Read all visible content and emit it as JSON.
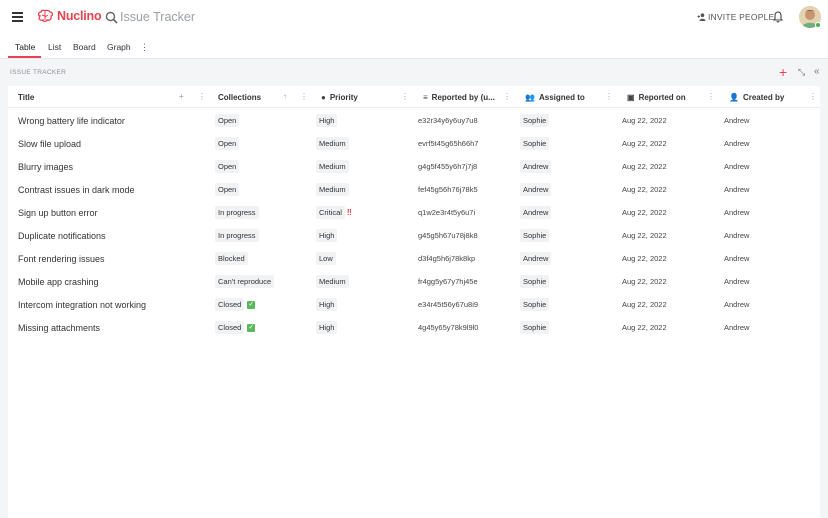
{
  "header": {
    "app_name": "Nuclino",
    "search_text": "Issue Tracker",
    "invite_label": "INVITE PEOPLE"
  },
  "tabs": [
    {
      "label": "Table"
    },
    {
      "label": "List"
    },
    {
      "label": "Board"
    },
    {
      "label": "Graph"
    }
  ],
  "tab_more": "⋮",
  "section": {
    "label": "ISSUE TRACKER"
  },
  "table": {
    "columns": [
      {
        "label": "Title",
        "icon": ""
      },
      {
        "label": "Collections",
        "icon": ""
      },
      {
        "label": "Priority",
        "icon": "●"
      },
      {
        "label": "Reported by (u...",
        "icon": "≡"
      },
      {
        "label": "Assigned to",
        "icon": "👥"
      },
      {
        "label": "Reported on",
        "icon": "▣"
      },
      {
        "label": "Created by",
        "icon": "👤"
      }
    ],
    "rows": [
      {
        "title": "Wrong battery life indicator",
        "collection": "Open",
        "priority": "High",
        "reporter": "e32r34y6y6uy7u8",
        "assignee": "Sophie",
        "date": "Aug 22, 2022",
        "creator": "Andrew",
        "done": false,
        "critical": false
      },
      {
        "title": "Slow file upload",
        "collection": "Open",
        "priority": "Medium",
        "reporter": "evrf5t45g65h66h7",
        "assignee": "Sophie",
        "date": "Aug 22, 2022",
        "creator": "Andrew",
        "done": false,
        "critical": false
      },
      {
        "title": "Blurry images",
        "collection": "Open",
        "priority": "Medium",
        "reporter": "g4g5f455y6h7j7j8",
        "assignee": "Andrew",
        "date": "Aug 22, 2022",
        "creator": "Andrew",
        "done": false,
        "critical": false
      },
      {
        "title": "Contrast issues in dark mode",
        "collection": "Open",
        "priority": "Medium",
        "reporter": "fef45g56h76j78k5",
        "assignee": "Andrew",
        "date": "Aug 22, 2022",
        "creator": "Andrew",
        "done": false,
        "critical": false
      },
      {
        "title": "Sign up button error",
        "collection": "In progress",
        "priority": "Critical",
        "reporter": "q1w2e3r4t5y6u7i",
        "assignee": "Andrew",
        "date": "Aug 22, 2022",
        "creator": "Andrew",
        "done": false,
        "critical": true
      },
      {
        "title": "Duplicate notifications",
        "collection": "In progress",
        "priority": "High",
        "reporter": "g45g5h67u78j8k8",
        "assignee": "Sophie",
        "date": "Aug 22, 2022",
        "creator": "Andrew",
        "done": false,
        "critical": false
      },
      {
        "title": "Font rendering issues",
        "collection": "Blocked",
        "priority": "Low",
        "reporter": "d3f4g5h6j78k8kp",
        "assignee": "Andrew",
        "date": "Aug 22, 2022",
        "creator": "Andrew",
        "done": false,
        "critical": false
      },
      {
        "title": "Mobile app crashing",
        "collection": "Can't reproduce",
        "priority": "Medium",
        "reporter": "fr4gg5y67y7hj45e",
        "assignee": "Sophie",
        "date": "Aug 22, 2022",
        "creator": "Andrew",
        "done": false,
        "critical": false
      },
      {
        "title": "Intercom integration not working",
        "collection": "Closed",
        "priority": "High",
        "reporter": "e34r45t56y67u8i9",
        "assignee": "Sophie",
        "date": "Aug 22, 2022",
        "creator": "Andrew",
        "done": true,
        "critical": false
      },
      {
        "title": "Missing attachments",
        "collection": "Closed",
        "priority": "High",
        "reporter": "4g45y65y78k9l9l0",
        "assignee": "Sophie",
        "date": "Aug 22, 2022",
        "creator": "Andrew",
        "done": true,
        "critical": false
      }
    ]
  },
  "colors": {
    "accent": "#e8414f",
    "done": "#5cb85c",
    "chip_bg": "#f1f2f4"
  }
}
